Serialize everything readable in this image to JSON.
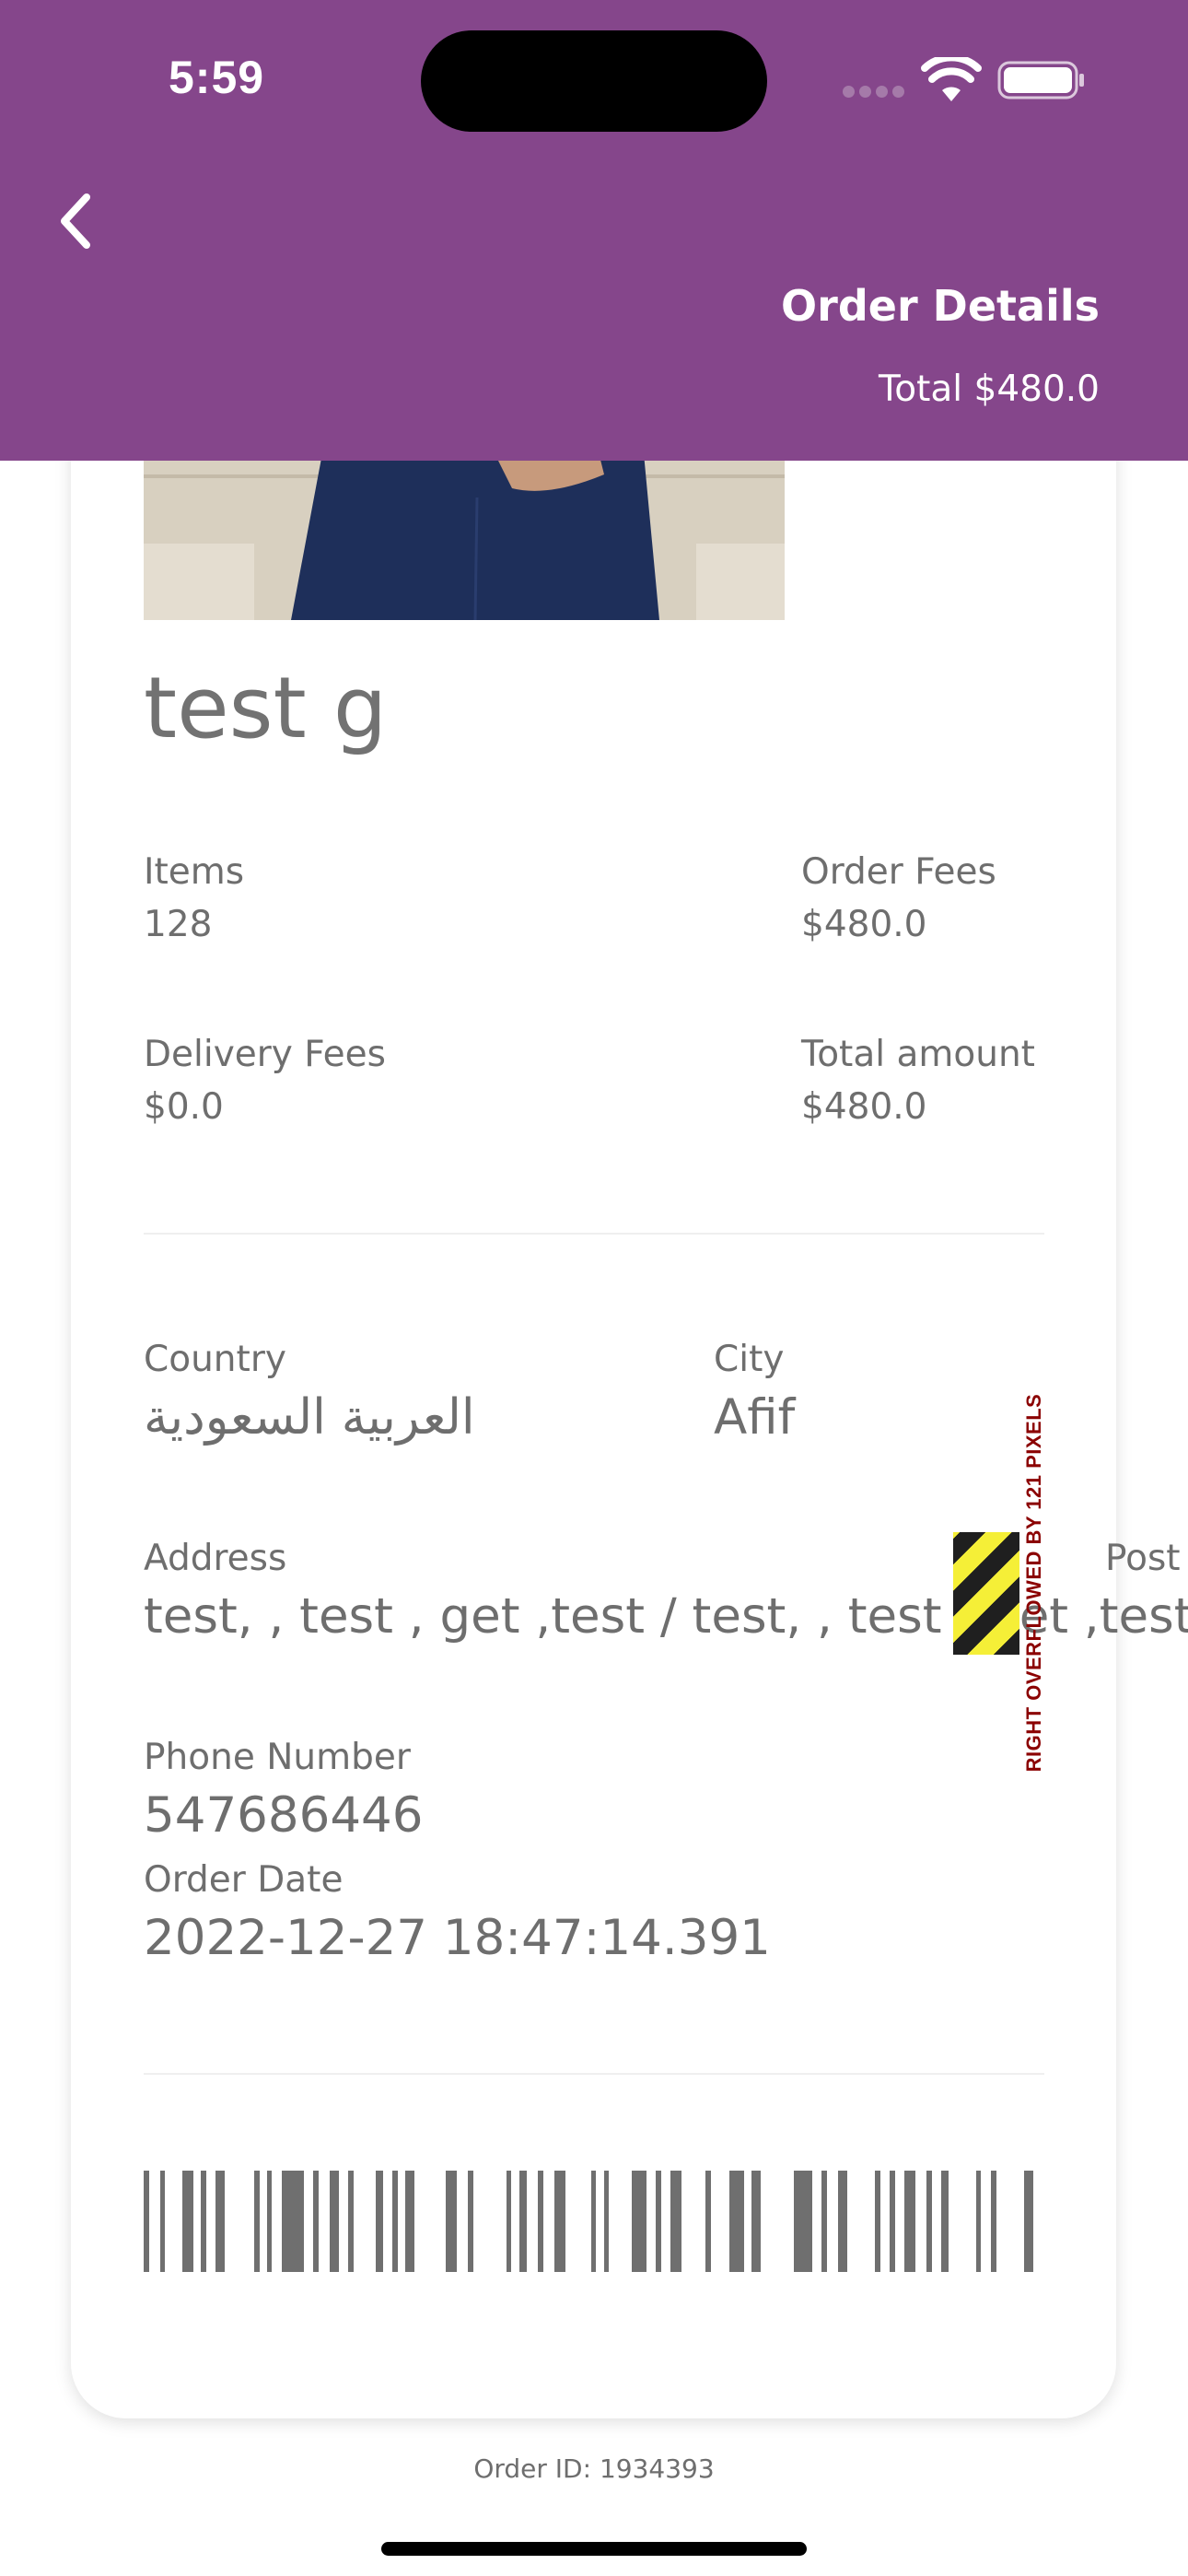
{
  "status_bar": {
    "time": "5:59"
  },
  "header": {
    "title": "Order Details",
    "total": "Total $480.0",
    "background_color": "#85468b",
    "back_icon": "chevron-left-icon"
  },
  "product": {
    "name": "test g"
  },
  "summary": {
    "items_label": "Items",
    "items_value": "128",
    "order_fees_label": "Order Fees",
    "order_fees_value": "$480.0",
    "delivery_fees_label": "Delivery Fees",
    "delivery_fees_value": "$0.0",
    "total_amount_label": "Total amount",
    "total_amount_value": "$480.0"
  },
  "shipping": {
    "country_label": "Country",
    "country_value": "العربية السعودية",
    "city_label": "City",
    "city_value": "Afif",
    "address_label": "Address",
    "address_value": "test, , test , get ,test / test, , test , get ,test",
    "post_label": "Post",
    "phone_label": "Phone Number",
    "phone_value": "547686446",
    "order_date_label": "Order Date",
    "order_date_value": "2022-12-27 18:47:14.391"
  },
  "overflow_warning": {
    "text": "RIGHT OVERFLOWED BY 121 PIXELS"
  },
  "footer": {
    "order_id": "Order ID:  1934393"
  }
}
